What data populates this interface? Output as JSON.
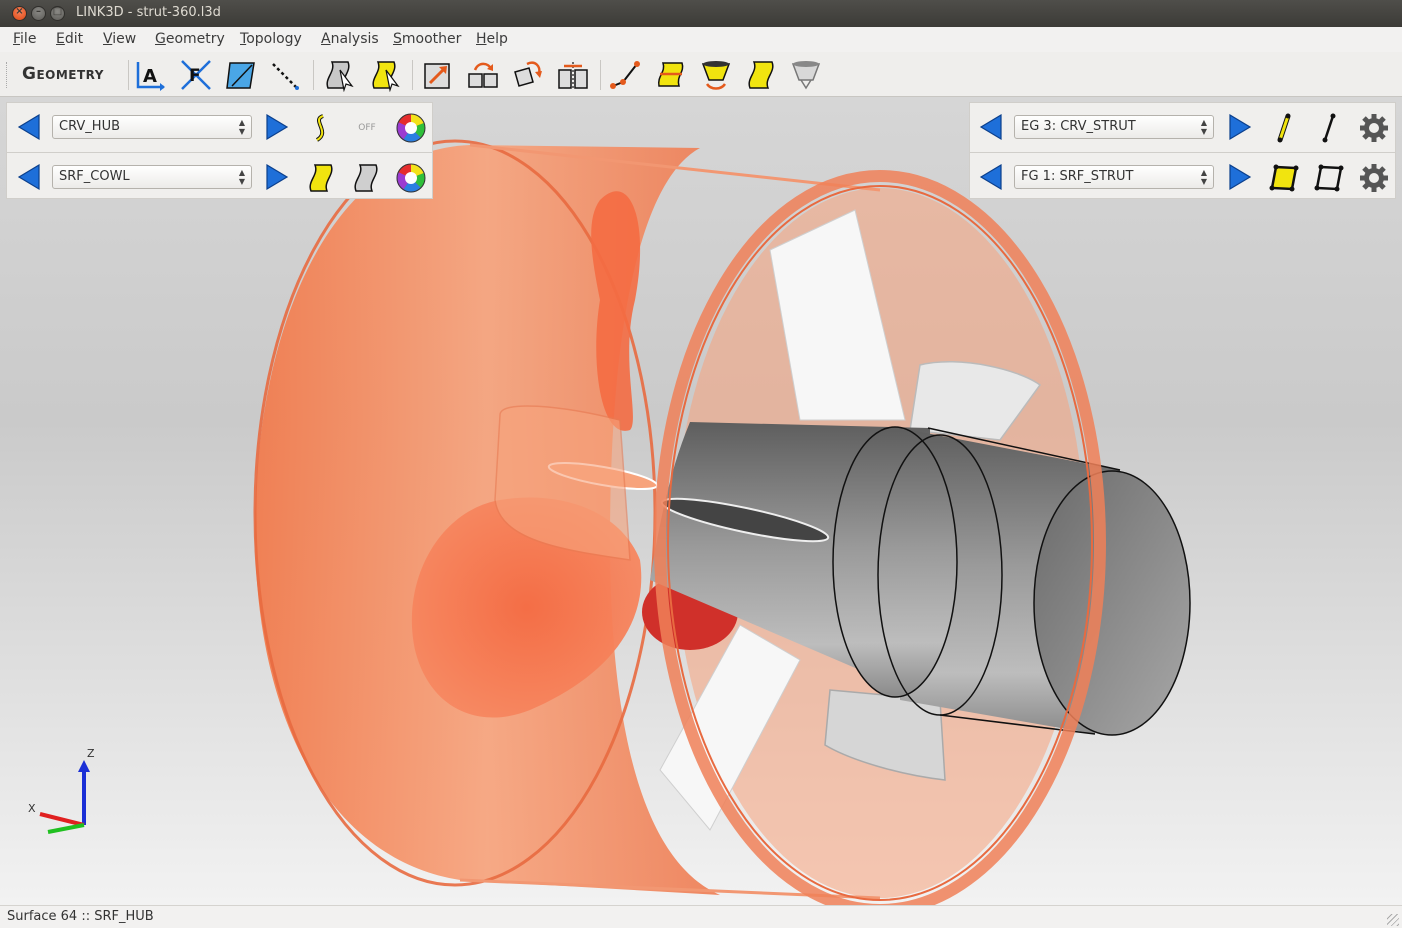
{
  "window": {
    "title": "LINK3D - strut-360.l3d"
  },
  "menu": [
    {
      "label": "File",
      "key": "F",
      "rest": "ile"
    },
    {
      "label": "Edit",
      "key": "E",
      "rest": "dit"
    },
    {
      "label": "View",
      "key": "V",
      "rest": "iew"
    },
    {
      "label": "Geometry",
      "key": "G",
      "rest": "eometry"
    },
    {
      "label": "Topology",
      "key": "T",
      "rest": "opology"
    },
    {
      "label": "Analysis",
      "key": "A",
      "rest": "nalysis"
    },
    {
      "label": "Smoother",
      "key": "S",
      "rest": "moother"
    },
    {
      "label": "Help",
      "key": "H",
      "rest": "elp"
    }
  ],
  "toolbar": {
    "mode_label": "Geometry",
    "icons": [
      "label-a-icon",
      "label-f-icon",
      "surface-normal-icon",
      "dashed-line-icon",
      "select-curve-icon",
      "select-surface-icon",
      "scale-icon",
      "translate-icon",
      "rotate-icon",
      "mirror-icon",
      "curve-points-icon",
      "surface-loft-icon",
      "surface-revolve-icon",
      "surface-patch-icon",
      "surface-sweep-icon"
    ]
  },
  "left_panel": {
    "curve_combo": "CRV_HUB",
    "surface_combo": "SRF_COWL",
    "off_label": "OFF"
  },
  "right_panel": {
    "edge_group_combo": "EG 3: CRV_STRUT",
    "face_group_combo": "FG 1: SRF_STRUT"
  },
  "axes": {
    "z_label": "Z",
    "x_label": "X"
  },
  "status": {
    "text": "Surface 64 :: SRF_HUB"
  },
  "colors": {
    "cowl": "#f5875a",
    "hub": "#7a7a7a",
    "strut": "#f4f4f4",
    "accent_blue": "#1e6fd9",
    "icon_yellow": "#f1e40f"
  }
}
